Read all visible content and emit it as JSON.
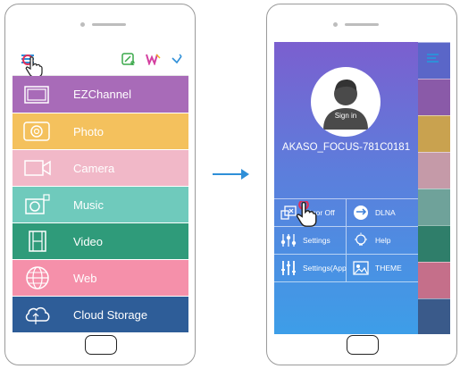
{
  "left_screen": {
    "menu_items": [
      {
        "label": "EZChannel",
        "color": "#a86bb8",
        "icon": "tv-icon"
      },
      {
        "label": "Photo",
        "color": "#f4c15d",
        "icon": "camera-lens-icon"
      },
      {
        "label": "Camera",
        "color": "#f1b8c8",
        "icon": "video-camera-icon"
      },
      {
        "label": "Music",
        "color": "#6fcabc",
        "icon": "music-camera-icon"
      },
      {
        "label": "Video",
        "color": "#2f9b7a",
        "icon": "film-icon"
      },
      {
        "label": "Web",
        "color": "#f590aa",
        "icon": "globe-icon"
      },
      {
        "label": "Cloud Storage",
        "color": "#2e5d98",
        "icon": "cloud-icon"
      }
    ]
  },
  "right_screen": {
    "signin_label": "Sign in",
    "device_name": "AKASO_FOCUS-781C0181",
    "drawer_grid": [
      [
        {
          "label": "Mirror Off",
          "icon": "mirror-icon"
        },
        {
          "label": "DLNA",
          "icon": "dlna-icon"
        }
      ],
      [
        {
          "label": "Settings",
          "icon": "sliders-icon"
        },
        {
          "label": "Help",
          "icon": "help-bulb-icon"
        }
      ],
      [
        {
          "label": "Settings(App",
          "icon": "equalizer-icon"
        },
        {
          "label": "THEME",
          "icon": "theme-icon"
        }
      ]
    ],
    "side_strip_colors": [
      "#5a66c8",
      "#8a5aa8",
      "#c9a24f",
      "#c59aa8",
      "#6fa29a",
      "#2f7e6a",
      "#c56f8a",
      "#3a5a8a"
    ]
  }
}
